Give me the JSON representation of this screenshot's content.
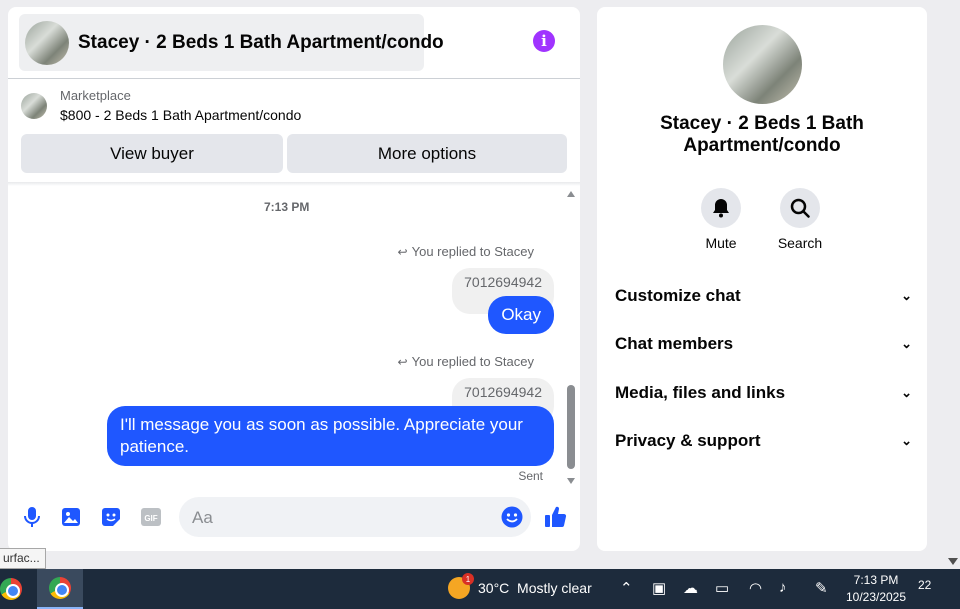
{
  "chat": {
    "title": "Stacey · 2 Beds 1 Bath Apartment/condo",
    "listing_source": "Marketplace",
    "listing_title": "$800 - 2 Beds 1 Bath Apartment/condo",
    "view_buyer_label": "View buyer",
    "more_options_label": "More options",
    "timestamp": "7:13 PM",
    "messages": [
      {
        "reply_note": "You replied to Stacey",
        "quoted": "7012694942",
        "text": "Okay"
      },
      {
        "reply_note": "You replied to Stacey",
        "quoted": "7012694942",
        "text": "I'll message you as soon as possible. Appreciate your patience."
      }
    ],
    "sent_label": "Sent",
    "composer_placeholder": "Aa",
    "composer_icons": [
      "microphone-icon",
      "photo-icon",
      "sticker-icon",
      "gif-icon",
      "emoji-icon",
      "thumbs-up-icon"
    ],
    "accent_color": "#1f57ff"
  },
  "details": {
    "title": "Stacey · 2 Beds 1 Bath Apartment/condo",
    "actions": [
      {
        "label": "Mute",
        "icon": "bell-icon"
      },
      {
        "label": "Search",
        "icon": "search-icon"
      }
    ],
    "sections": [
      "Customize chat",
      "Chat members",
      "Media, files and links",
      "Privacy & support"
    ]
  },
  "tooltip": "urfac...",
  "taskbar": {
    "weather": "30°C  Mostly clear",
    "weather_badge": "1",
    "time": "7:13 PM",
    "date": "10/23/2025",
    "notification_count": "22"
  }
}
